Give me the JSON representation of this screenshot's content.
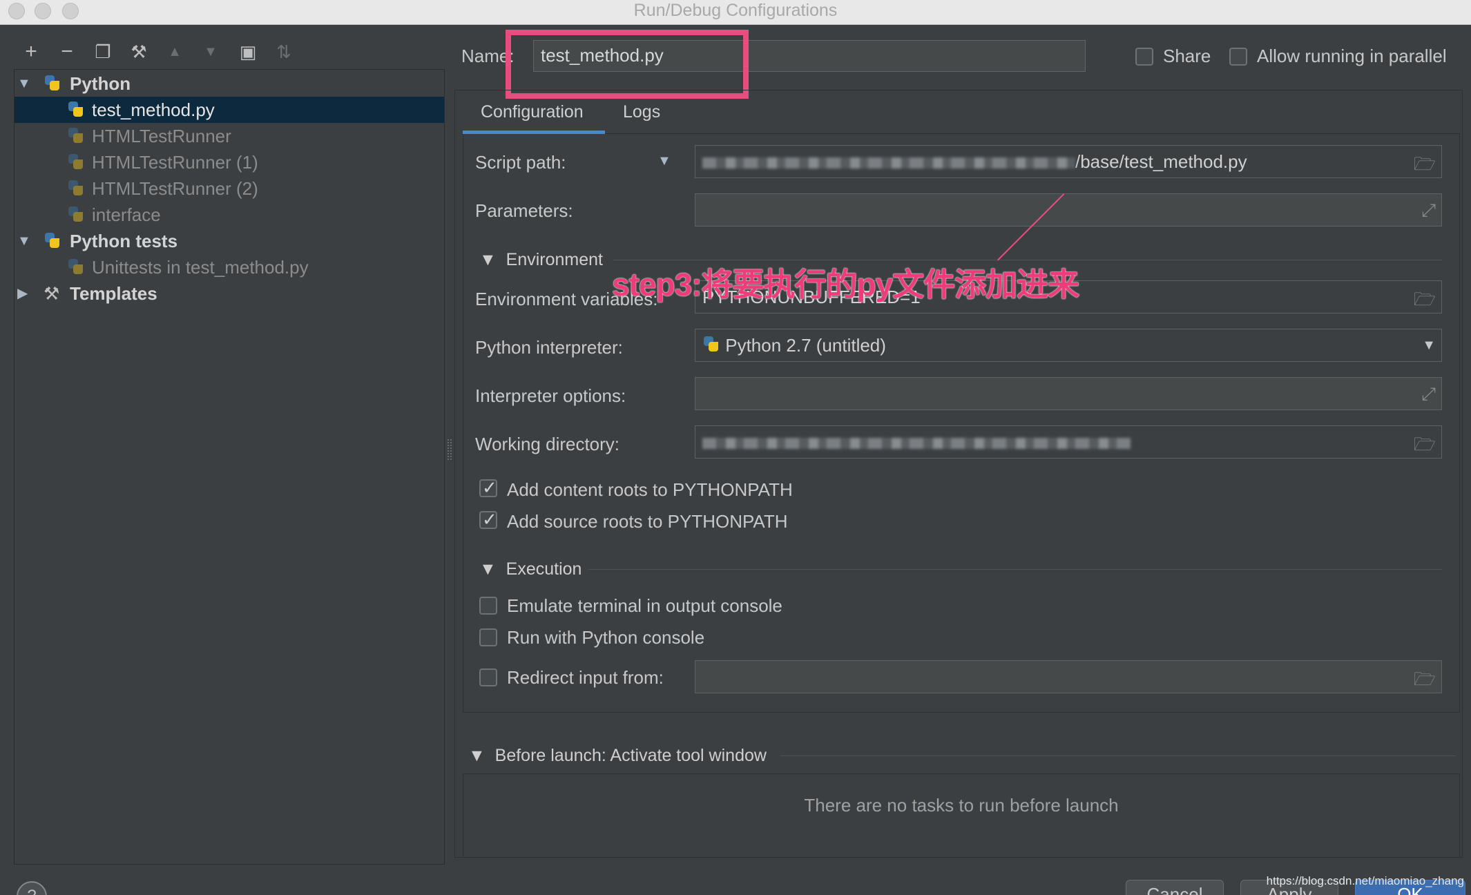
{
  "window": {
    "title": "Run/Debug Configurations"
  },
  "toolbar": {
    "add": "+",
    "remove": "−",
    "copy": "❐",
    "edit": "⚒",
    "up": "▲",
    "down": "▼",
    "folder": "▣",
    "sort": "⇅"
  },
  "tree": {
    "python_group": "Python",
    "items": [
      "test_method.py",
      "HTMLTestRunner",
      "HTMLTestRunner (1)",
      "HTMLTestRunner (2)",
      "interface"
    ],
    "python_tests_group": "Python tests",
    "test_items": [
      "Unittests in test_method.py"
    ],
    "templates": "Templates"
  },
  "header": {
    "name_label": "Name:",
    "name_value": "test_method.py",
    "share_label": "Share",
    "parallel_label": "Allow running in parallel"
  },
  "tabs": [
    "Configuration",
    "Logs"
  ],
  "form": {
    "script_path_label": "Script path:",
    "script_path_value": "/base/test_method.py",
    "parameters_label": "Parameters:",
    "environment_header": "Environment",
    "env_vars_label": "Environment variables:",
    "env_vars_value": "PYTHONUNBUFFERED=1",
    "interpreter_label": "Python interpreter:",
    "interpreter_value": "Python 2.7 (untitled)",
    "interp_options_label": "Interpreter options:",
    "working_dir_label": "Working directory:",
    "content_roots_label": "Add content roots to PYTHONPATH",
    "source_roots_label": "Add source roots to PYTHONPATH",
    "execution_header": "Execution",
    "emulate_terminal_label": "Emulate terminal in output console",
    "python_console_label": "Run with Python console",
    "redirect_label": "Redirect input from:"
  },
  "before_launch": {
    "header": "Before launch: Activate tool window",
    "empty_text": "There are no tasks to run before launch"
  },
  "annotation": {
    "text": "step3:将要执行的py文件添加进来"
  },
  "buttons": {
    "help": "?",
    "cancel": "Cancel",
    "apply": "Apply",
    "ok": "OK"
  },
  "watermark": "https://blog.csdn.net/miaomiao_zhang"
}
